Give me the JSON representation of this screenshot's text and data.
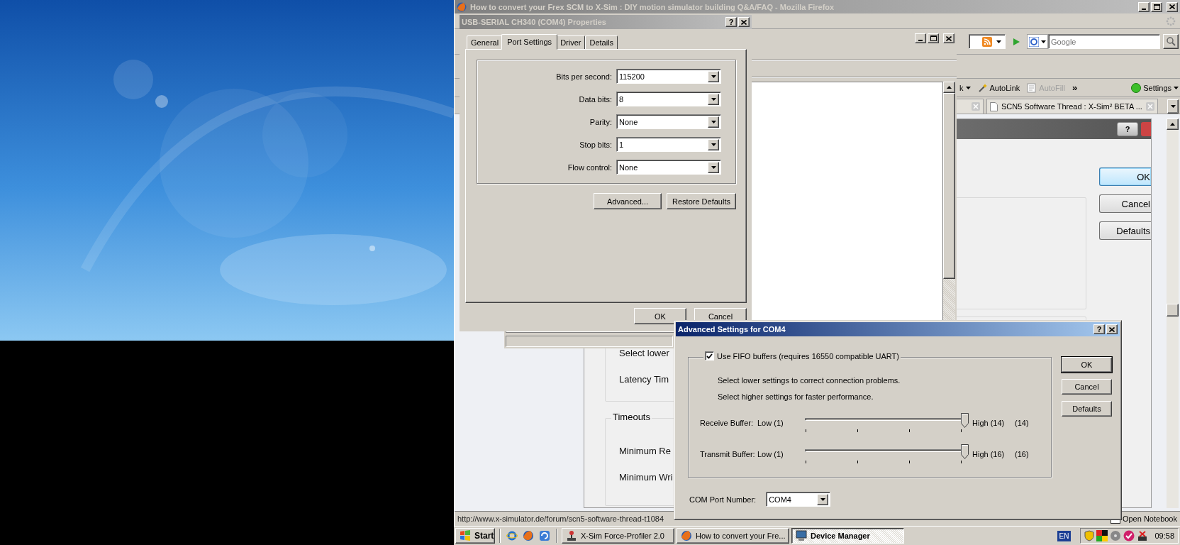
{
  "browser": {
    "title": "How to convert your Frex SCM to X-Sim : DIY motion simulator building Q&A/FAQ - Mozilla Firefox",
    "search": {
      "placeholder": "Google"
    },
    "toolbar": [
      {
        "kind": "dropdown",
        "label": "k",
        "disabled": false
      },
      {
        "kind": "link",
        "label": "AutoLink",
        "disabled": false
      },
      {
        "kind": "form",
        "label": "AutoFill",
        "disabled": true
      },
      {
        "kind": "chevron",
        "label": "»",
        "disabled": false
      }
    ],
    "settings": "Settings",
    "tabs": [
      {
        "label": "SCN5 Software Thread : X-Sim² BETA ...",
        "selected": false
      }
    ],
    "status_url": "http://www.x-simulator.de/forum/scn5-software-thread-t1084",
    "status_right": "Open Notebook"
  },
  "driver_dialog": {
    "help": "?",
    "groups": [
      {
        "lines": [
          "Select lower",
          "Latency Tim"
        ]
      },
      {
        "legend": "Timeouts",
        "lines": [
          "Minimum Re",
          "Minimum Wri"
        ]
      }
    ],
    "buttons": [
      {
        "label": "OK",
        "default": true
      },
      {
        "label": "Cancel",
        "default": false
      },
      {
        "label": "Defaults",
        "default": false
      }
    ]
  },
  "properties": {
    "title": "USB-SERIAL CH340 (COM4) Properties",
    "help": "?",
    "tabs": [
      {
        "label": "General",
        "selected": false
      },
      {
        "label": "Port Settings",
        "selected": true
      },
      {
        "label": "Driver",
        "selected": false
      },
      {
        "label": "Details",
        "selected": false
      }
    ],
    "fields": [
      {
        "label": "Bits per second:",
        "value": "115200"
      },
      {
        "label": "Data bits:",
        "value": "8"
      },
      {
        "label": "Parity:",
        "value": "None"
      },
      {
        "label": "Stop bits:",
        "value": "1"
      },
      {
        "label": "Flow control:",
        "value": "None"
      }
    ],
    "buttons": [
      "Advanced...",
      "Restore Defaults"
    ],
    "footer_buttons": [
      "OK",
      "Cancel"
    ]
  },
  "advanced": {
    "title": "Advanced Settings for COM4",
    "help": "?",
    "fifo": {
      "label": "Use FIFO buffers (requires 16550 compatible UART)",
      "checked": true
    },
    "notes": [
      "Select lower settings to correct connection problems.",
      "Select higher settings for faster performance."
    ],
    "buffers": [
      {
        "label": "Receive Buffer:",
        "low": "Low (1)",
        "high": "High (14)",
        "reading": "(14)",
        "level": 1
      },
      {
        "label": "Transmit Buffer:",
        "low": "Low (1)",
        "high": "High (16)",
        "reading": "(16)",
        "level": 1
      }
    ],
    "com_port": {
      "label": "COM Port Number:",
      "value": "COM4"
    },
    "buttons": [
      {
        "label": "OK",
        "default": true
      },
      {
        "label": "Cancel",
        "default": false
      },
      {
        "label": "Defaults",
        "default": false
      }
    ]
  },
  "taskbar": {
    "start": "Start",
    "tasks": [
      {
        "label": "X-Sim Force-Profiler 2.0",
        "selected": false
      },
      {
        "label": "How to convert your Fre...",
        "selected": false
      },
      {
        "label": "Device Manager",
        "selected": true
      }
    ],
    "language": "EN",
    "clock": "09:58"
  }
}
